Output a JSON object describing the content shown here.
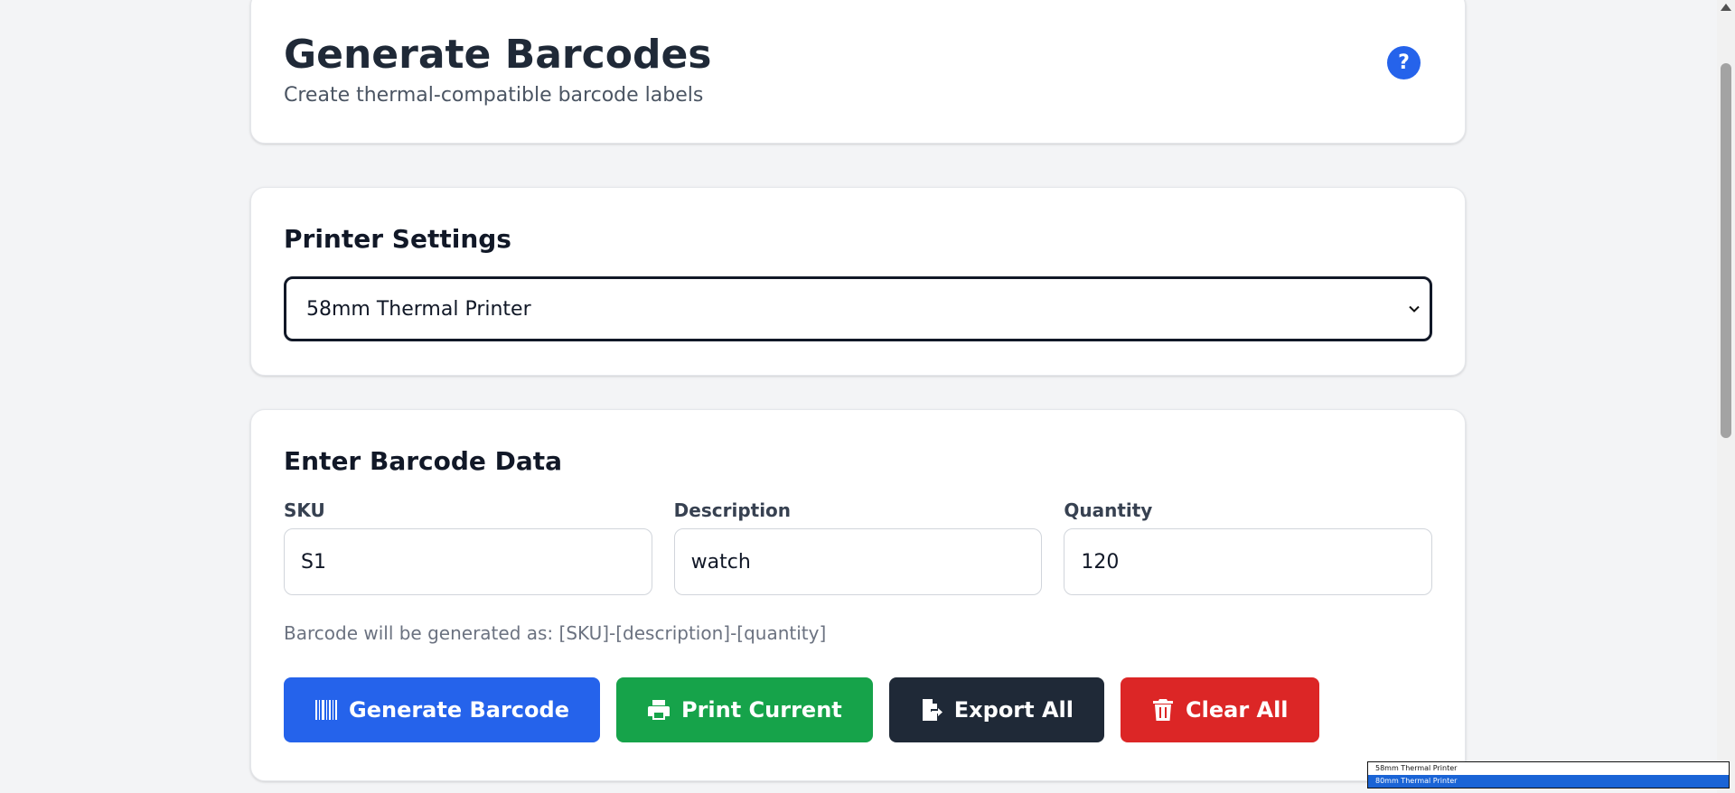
{
  "header": {
    "title": "Generate Barcodes",
    "subtitle": "Create thermal-compatible barcode labels",
    "help_label": "?"
  },
  "printer_settings": {
    "title": "Printer Settings",
    "selected": "58mm Thermal Printer",
    "options": [
      "58mm Thermal Printer",
      "80mm Thermal Printer"
    ]
  },
  "barcode_data": {
    "title": "Enter Barcode Data",
    "fields": [
      {
        "label": "SKU",
        "value": "S1"
      },
      {
        "label": "Description",
        "value": "watch"
      },
      {
        "label": "Quantity",
        "value": "120"
      }
    ],
    "hint": "Barcode will be generated as: [SKU]-[description]-[quantity]"
  },
  "actions": {
    "generate": "Generate Barcode",
    "print": "Print Current",
    "export": "Export All",
    "clear": "Clear All"
  },
  "colors": {
    "primary": "#2563eb",
    "success": "#16a34a",
    "dark": "#1f2937",
    "danger": "#dc2626"
  },
  "icons": {
    "generate": "barcode-icon",
    "print": "printer-icon",
    "export": "file-export-icon",
    "clear": "trash-icon",
    "select": "chevron-down-icon",
    "help": "question-icon"
  }
}
